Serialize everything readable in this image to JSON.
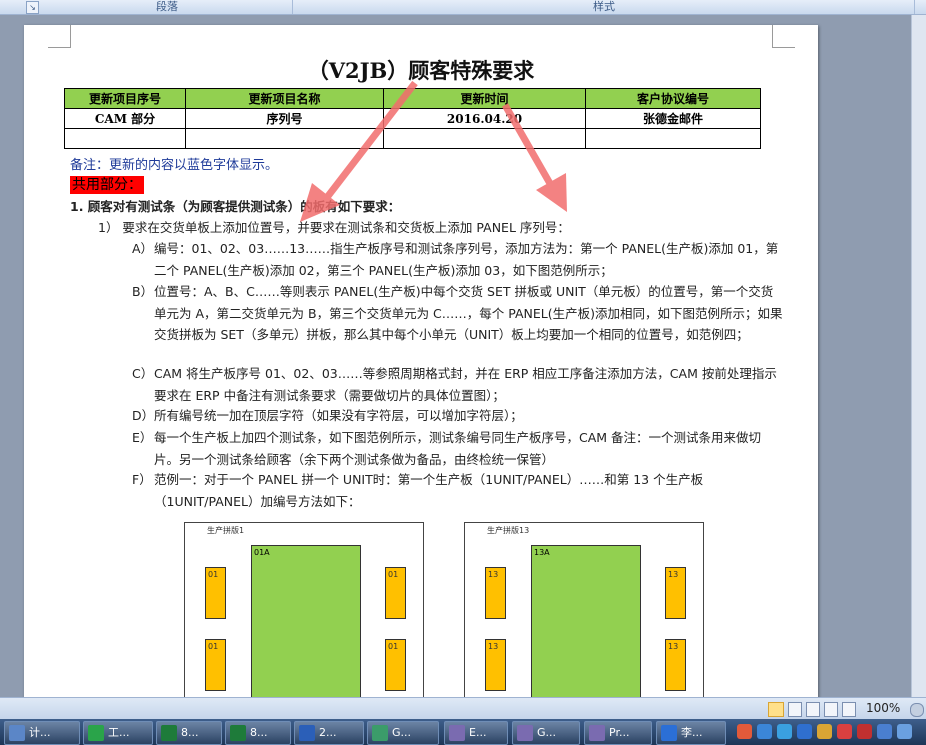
{
  "ribbon": {
    "group_paragraph": "段落",
    "group_styles": "样式"
  },
  "doc": {
    "title": "（V2JB）顾客特殊要求",
    "table": {
      "headers": [
        "更新项目序号",
        "更新项目名称",
        "更新时间",
        "客户协议编号"
      ],
      "rows": [
        [
          "CAM 部分",
          "序列号",
          "2016.04.20",
          "张德金邮件"
        ],
        [
          "",
          "",
          "",
          ""
        ]
      ]
    },
    "note": "备注：更新的内容以蓝色字体显示。",
    "common_label": "共用部分：",
    "item1": "1.    顾客对有测试条（为顾客提供测试条）的板有如下要求：",
    "item1_1": "1）  要求在交货单板上添加位置号，并要求在测试条和交货板上添加 PANEL 序列号：",
    "sub": [
      {
        "lbl": "A）",
        "text": "编号：01、02、03……13……指生产板序号和测试条序列号，添加方法为：第一个 PANEL(生产板)添加 01，第二个 PANEL(生产板)添加 02，第三个 PANEL(生产板)添加 03，如下图范例所示；"
      },
      {
        "lbl": "B）",
        "text": "位置号：A、B、C……等则表示 PANEL(生产板)中每个交货 SET 拼板或 UNIT（单元板）的位置号，第一个交货单元为 A，第二交货单元为 B，第三个交货单元为 C……，每个 PANEL(生产板)添加相同，如下图范例所示；如果交货拼板为 SET（多单元）拼板，那么其中每个小单元（UNIT）板上均要加一个相同的位置号，如范例四；"
      },
      {
        "lbl": "C）",
        "text": "CAM 将生产板序号 01、02、03……等参照周期格式封，并在 ERP 相应工序备注添加方法，CAM 按前处理指示要求在 ERP 中备注有测试条要求（需要做切片的具体位置图）；"
      },
      {
        "lbl": "D）",
        "text": "所有编号统一加在顶层字符（如果没有字符层，可以增加字符层）；"
      },
      {
        "lbl": "E）",
        "text": "每一个生产板上加四个测试条，如下图范例所示，测试条编号同生产板序号，CAM 备注：一个测试条用来做切片。另一个测试条给顾客（余下两个测试条做为备品，由终检统一保管）"
      },
      {
        "lbl": "F）",
        "text": "范例一：对于一个 PANEL 拼一个 UNIT时：第一个生产板（1UNIT/PANEL）……和第 13 个生产板（1UNIT/PANEL）加编号方法如下："
      }
    ],
    "diagrams": [
      {
        "label": "生产拼版1",
        "unit": "01A",
        "coupon": "01"
      },
      {
        "label": "生产拼版13",
        "unit": "13A",
        "coupon": "13"
      }
    ]
  },
  "status": {
    "zoom": "100%"
  },
  "taskbar": [
    {
      "text": "计...",
      "color": "#5b86c7"
    },
    {
      "text": "工...",
      "color": "#2aa44a"
    },
    {
      "text": "8...",
      "color": "#1e7b3a"
    },
    {
      "text": "8...",
      "color": "#1e7b3a"
    },
    {
      "text": "2...",
      "color": "#2b5fb8"
    },
    {
      "text": "G...",
      "color": "#3b9c6a"
    },
    {
      "text": "E...",
      "color": "#7a6bb0"
    },
    {
      "text": "G...",
      "color": "#7a6bb0"
    },
    {
      "text": "Pr...",
      "color": "#7a6bb0"
    },
    {
      "text": "李...",
      "color": "#2b6fd6"
    }
  ]
}
